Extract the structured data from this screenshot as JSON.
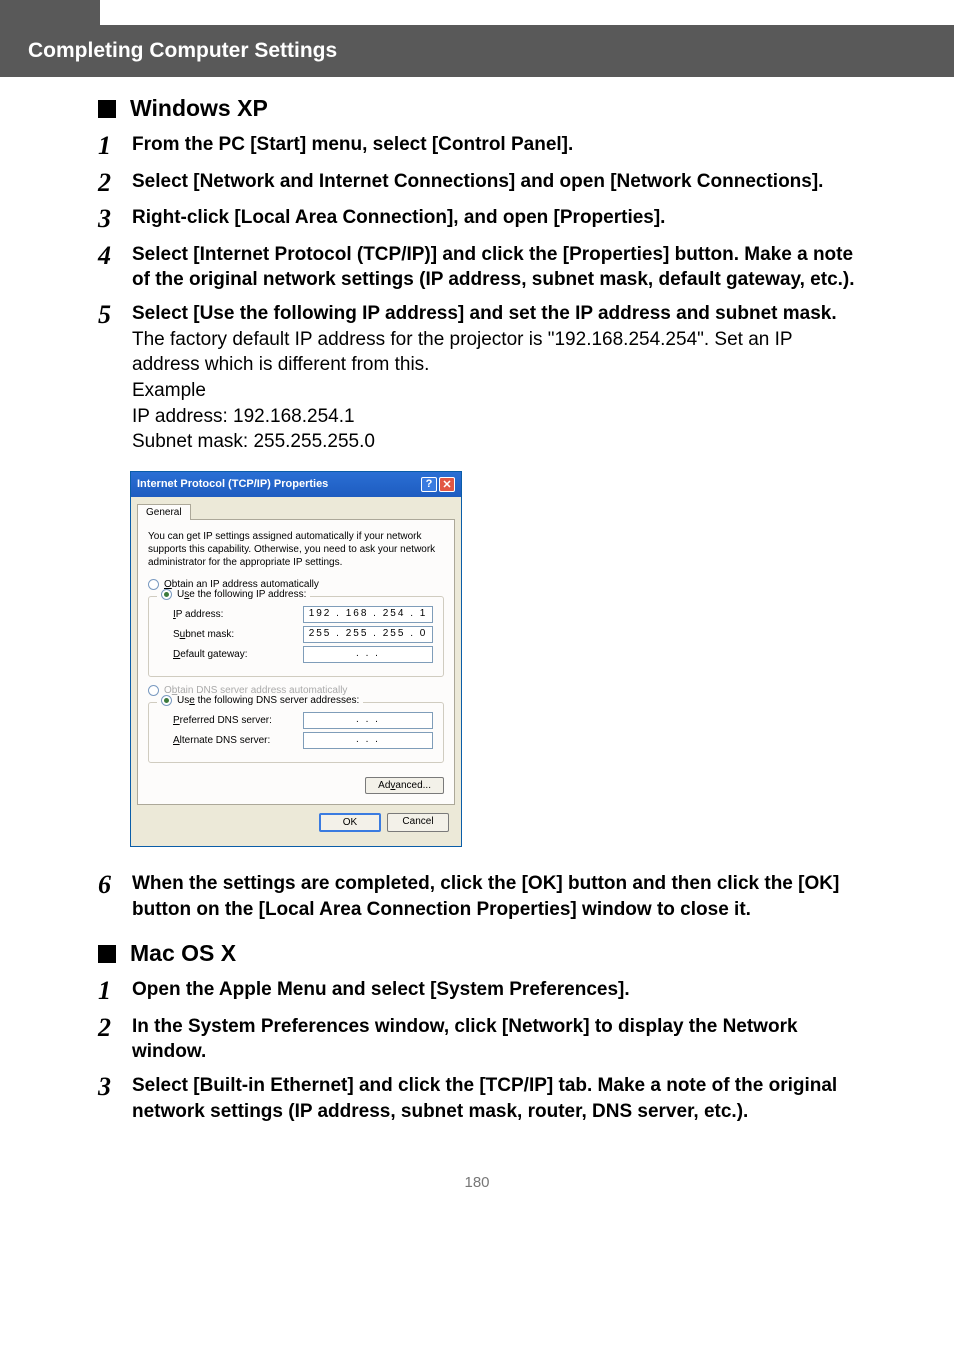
{
  "header": {
    "title": "Completing Computer Settings"
  },
  "sections": {
    "winxp": {
      "title": "Windows XP",
      "steps": {
        "s1_bold": "From the PC [Start] menu, select [Control Panel].",
        "s2_bold": "Select [Network and Internet Connections] and open [Network Connections].",
        "s3_bold": "Right-click [Local Area Connection], and open [Properties].",
        "s4_bold": "Select [Internet Protocol (TCP/IP)] and click the [Properties] button. Make a note of the original network settings (IP address, subnet mask, default gateway, etc.).",
        "s5_bold": "Select [Use the following IP address] and set the IP address and subnet mask.",
        "s5_plain": "The factory default IP address for the projector is \"192.168.254.254\". Set an IP address which is different from this.\nExample\nIP address: 192.168.254.1\nSubnet mask: 255.255.255.0",
        "s6_bold": "When the settings are completed, click the [OK] button and then click the [OK] button on the [Local Area Connection Properties] window to close it."
      }
    },
    "macosx": {
      "title": "Mac OS X",
      "steps": {
        "s1_bold": "Open the Apple Menu and select [System Preferences].",
        "s2_bold": "In the System Preferences window, click [Network] to display the Network window.",
        "s3_bold": "Select [Built-in Ethernet] and click the [TCP/IP] tab. Make a note of the original network settings (IP address, subnet mask, router, DNS server, etc.)."
      }
    }
  },
  "dialog": {
    "title": "Internet Protocol (TCP/IP) Properties",
    "tab": "General",
    "desc": "You can get IP settings assigned automatically if your network supports this capability. Otherwise, you need to ask your network administrator for the appropriate IP settings.",
    "radio_auto_ip": "Obtain an IP address automatically",
    "radio_use_ip": "Use the following IP address:",
    "label_ip": "IP address:",
    "label_subnet": "Subnet mask:",
    "label_gateway": "Default gateway:",
    "radio_auto_dns": "Obtain DNS server address automatically",
    "radio_use_dns": "Use the following DNS server addresses:",
    "label_pref_dns": "Preferred DNS server:",
    "label_alt_dns": "Alternate DNS server:",
    "val_ip": "192 . 168 . 254 .   1",
    "val_subnet": "255 . 255 . 255 .   0",
    "val_gateway": ".       .       .",
    "val_pref": ".       .       .",
    "val_alt": ".       .       .",
    "btn_advanced": "Advanced...",
    "btn_ok": "OK",
    "btn_cancel": "Cancel"
  },
  "nums": {
    "n1": "1",
    "n2": "2",
    "n3": "3",
    "n4": "4",
    "n5": "5",
    "n6": "6"
  },
  "page_number": "180"
}
